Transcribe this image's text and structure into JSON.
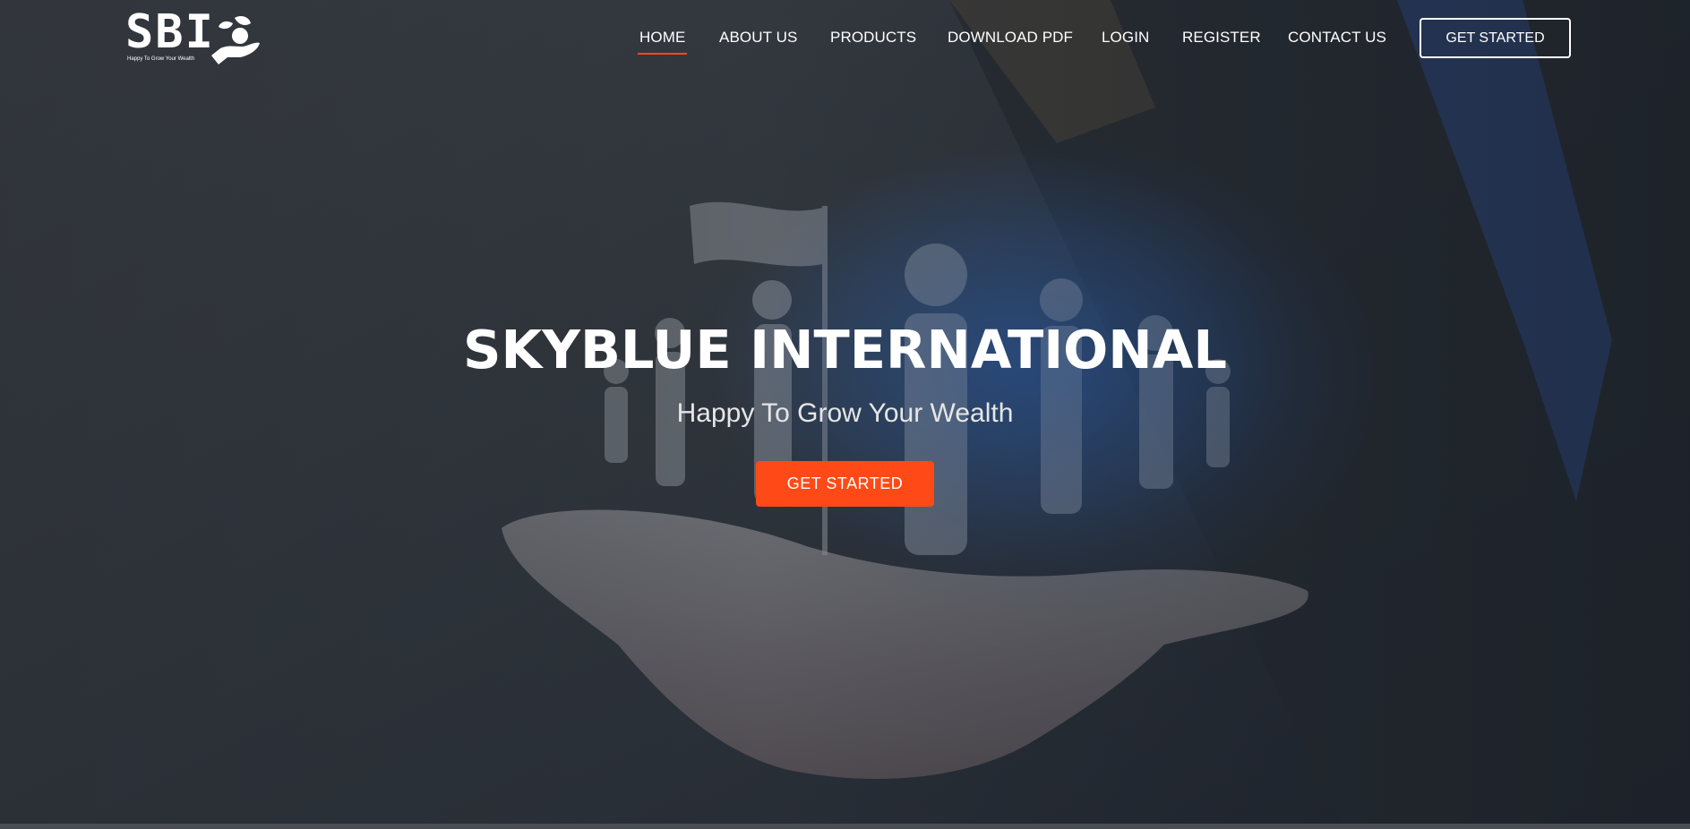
{
  "logo": {
    "text": "SBI",
    "tagline": "Happy To Grow Your Wealth",
    "icon": "hand-with-plant-icon"
  },
  "nav": {
    "items": [
      {
        "label": "HOME",
        "active": true
      },
      {
        "label": "ABOUT US",
        "active": false
      },
      {
        "label": "PRODUCTS",
        "active": false
      },
      {
        "label": "DOWNLOAD PDF",
        "active": false
      },
      {
        "label": "LOGIN",
        "active": false
      },
      {
        "label": "REGISTER",
        "active": false
      },
      {
        "label": "CONTACT US",
        "active": false
      }
    ],
    "cta_label": "GET STARTED"
  },
  "hero": {
    "title": "SKYBLUE INTERNATIONAL",
    "subtitle": "Happy To Grow Your Wealth",
    "cta_label": "GET STARTED"
  },
  "colors": {
    "accent": "#ff4a17",
    "text": "#ffffff"
  }
}
